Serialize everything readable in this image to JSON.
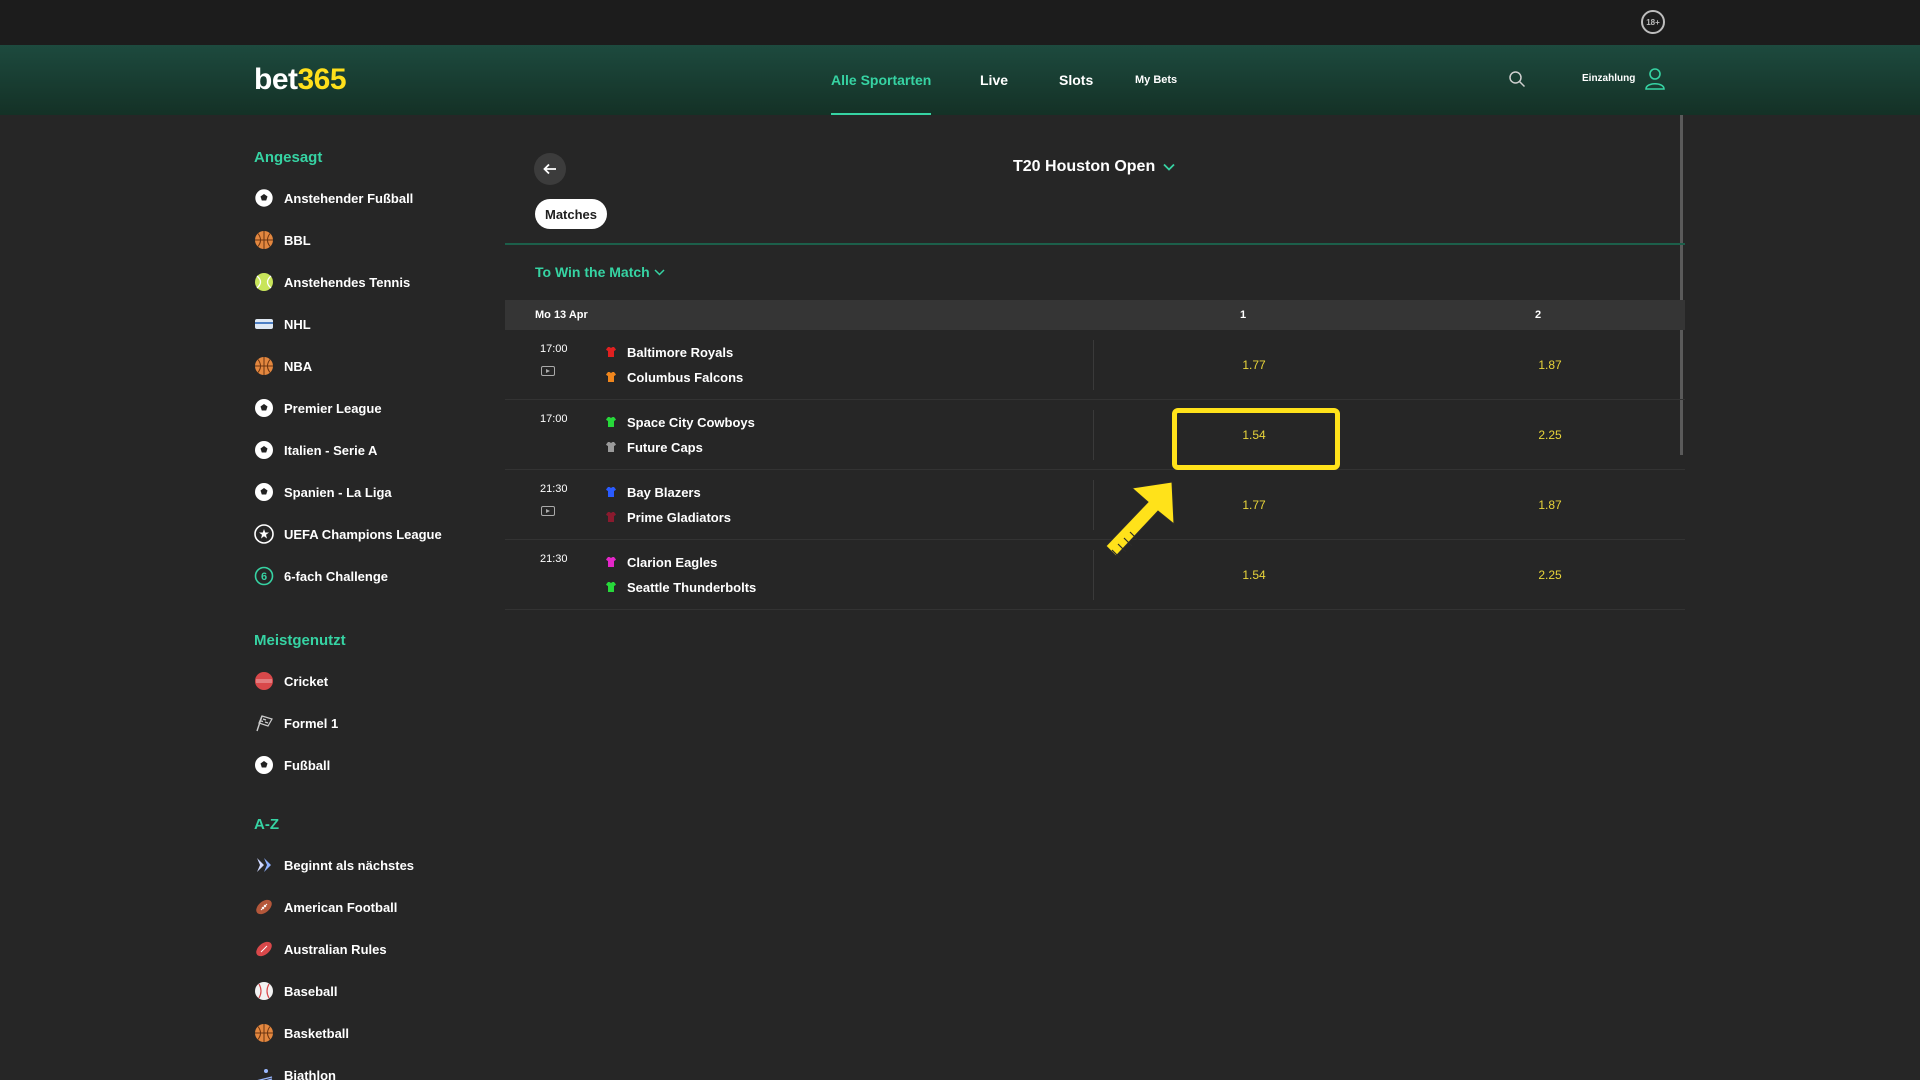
{
  "header": {
    "age_badge": "18+",
    "logo_part1": "bet",
    "logo_part2": "365",
    "nav": [
      {
        "label": "Alle Sportarten"
      },
      {
        "label": "Live"
      },
      {
        "label": "Slots"
      },
      {
        "label": "My Bets"
      }
    ],
    "deposit_label": "Einzahlung"
  },
  "sidebar": {
    "featured_title": "Angesagt",
    "featured": [
      {
        "label": "Anstehender Fußball",
        "icon": "soccer-ball-icon"
      },
      {
        "label": "BBL",
        "icon": "basketball-icon"
      },
      {
        "label": "Anstehendes Tennis",
        "icon": "tennis-ball-icon"
      },
      {
        "label": "NHL",
        "icon": "ice-hockey-icon"
      },
      {
        "label": "NBA",
        "icon": "basketball-icon"
      },
      {
        "label": "Premier League",
        "icon": "soccer-ball-icon"
      },
      {
        "label": "Italien - Serie A",
        "icon": "soccer-ball-icon"
      },
      {
        "label": "Spanien - La Liga",
        "icon": "soccer-ball-icon"
      },
      {
        "label": "UEFA Champions League",
        "icon": "champions-league-icon"
      },
      {
        "label": "6-fach Challenge",
        "icon": "six-challenge-icon"
      }
    ],
    "popular_title": "Meistgenutzt",
    "popular": [
      {
        "label": "Cricket",
        "icon": "cricket-ball-icon"
      },
      {
        "label": "Formel 1",
        "icon": "racing-flag-icon"
      },
      {
        "label": "Fußball",
        "icon": "soccer-ball-icon"
      }
    ],
    "az_title": "A-Z",
    "az": [
      {
        "label": "Beginnt als nächstes",
        "icon": "next-arrow-icon"
      },
      {
        "label": "American Football",
        "icon": "american-football-icon"
      },
      {
        "label": "Australian Rules",
        "icon": "aussie-rules-icon"
      },
      {
        "label": "Baseball",
        "icon": "baseball-icon"
      },
      {
        "label": "Basketball",
        "icon": "basketball-icon"
      },
      {
        "label": "Biathlon",
        "icon": "biathlon-icon"
      }
    ]
  },
  "main": {
    "competition": "T20 Houston Open",
    "tab": "Matches",
    "market": "To Win the Match",
    "date": "Mo 13 Apr",
    "col1": "1",
    "col2": "2",
    "matches": [
      {
        "time": "17:00",
        "stream": true,
        "home": "Baltimore Royals",
        "home_color": "#e02020",
        "away": "Columbus Falcons",
        "away_color": "#f0861d",
        "odd1": "1.77",
        "odd2": "1.87"
      },
      {
        "time": "17:00",
        "stream": false,
        "home": "Space City Cowboys",
        "home_color": "#27d83a",
        "away": "Future Caps",
        "away_color": "#9a9a9a",
        "odd1": "1.54",
        "odd2": "2.25"
      },
      {
        "time": "21:30",
        "stream": true,
        "home": "Bay Blazers",
        "home_color": "#2a5bff",
        "away": "Prime Gladiators",
        "away_color": "#8a1a2e",
        "odd1": "1.77",
        "odd2": "1.87"
      },
      {
        "time": "21:30",
        "stream": false,
        "home": "Clarion Eagles",
        "home_color": "#e426c8",
        "away": "Seattle Thunderbolts",
        "away_color": "#27d83a",
        "odd1": "1.54",
        "odd2": "2.25"
      }
    ]
  },
  "annotation": {
    "color": "#ffe21a"
  }
}
